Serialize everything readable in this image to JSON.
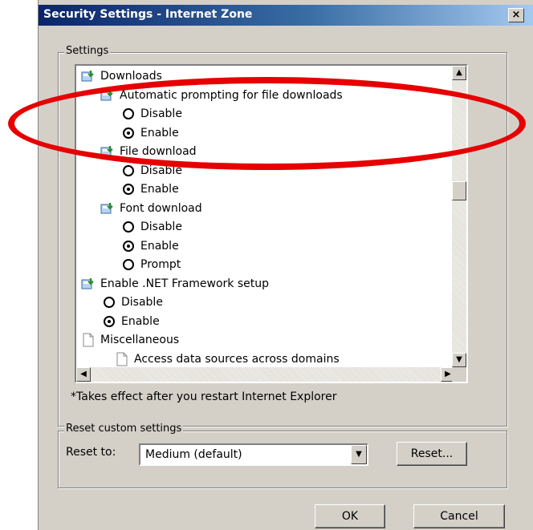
{
  "window": {
    "title": "Security Settings - Internet Zone",
    "close_label": "×"
  },
  "settings": {
    "group_label": "Settings",
    "items": [
      {
        "label": "Downloads",
        "type": "category",
        "icon": "downloads-icon"
      },
      {
        "label": "Automatic prompting for file downloads",
        "type": "setting",
        "icon": "setting-icon"
      },
      {
        "label": "Disable",
        "type": "radio",
        "checked": false
      },
      {
        "label": "Enable",
        "type": "radio",
        "checked": true
      },
      {
        "label": "File download",
        "type": "setting",
        "icon": "setting-icon"
      },
      {
        "label": "Disable",
        "type": "radio",
        "checked": false
      },
      {
        "label": "Enable",
        "type": "radio",
        "checked": true
      },
      {
        "label": "Font download",
        "type": "setting",
        "icon": "setting-icon"
      },
      {
        "label": "Disable",
        "type": "radio",
        "checked": false
      },
      {
        "label": "Enable",
        "type": "radio",
        "checked": true
      },
      {
        "label": "Prompt",
        "type": "radio",
        "checked": false
      },
      {
        "label": "Enable .NET Framework setup",
        "type": "category",
        "icon": "setting-icon"
      },
      {
        "label": "Disable",
        "type": "radio",
        "checked": false
      },
      {
        "label": "Enable",
        "type": "radio",
        "checked": true
      },
      {
        "label": "Miscellaneous",
        "type": "category",
        "icon": "document-icon"
      },
      {
        "label": "Access data sources across domains",
        "type": "setting",
        "icon": "document-icon"
      }
    ],
    "note": "*Takes effect after you restart Internet Explorer"
  },
  "reset": {
    "group_label": "Reset custom settings",
    "reset_to_label": "Reset to:",
    "selected": "Medium (default)",
    "reset_button": "Reset..."
  },
  "buttons": {
    "ok": "OK",
    "cancel": "Cancel"
  },
  "annotation_color": "#e60000"
}
